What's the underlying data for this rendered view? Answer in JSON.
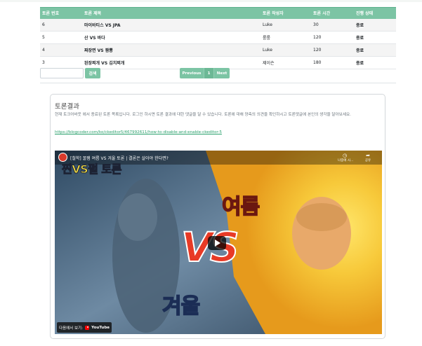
{
  "table": {
    "headers": [
      "토론 번호",
      "토론 제목",
      "토론 작성자",
      "토론 시간",
      "진행 상태"
    ],
    "rows": [
      {
        "no": "6",
        "title": "마이바티스 VS JPA",
        "author": "Luke",
        "time": "30",
        "status": "종료"
      },
      {
        "no": "5",
        "title": "산 VS 바다",
        "author": "룽룽",
        "time": "120",
        "status": "종료"
      },
      {
        "no": "4",
        "title": "짜장면 VS 짬뽕",
        "author": "Luke",
        "time": "120",
        "status": "종료"
      },
      {
        "no": "3",
        "title": "된장찌개 VS 김치찌개",
        "author": "제이슨",
        "time": "180",
        "status": "종료"
      }
    ]
  },
  "search": {
    "placeholder": "",
    "button_label": "검색"
  },
  "pagination": {
    "prev_label": "Previous",
    "current_page": "1",
    "next_label": "Next"
  },
  "result_card": {
    "title": "토론결과",
    "description": "현재 토크어바웃 에서 종료된 토론 목록입니다. 로그인 하시면 토론 결과에 대한 댓글을 달 수 있습니다. 토론에 대해 양측의 의견을 확인하시고 토론댓글에 본인의 생각을 달아보세요.",
    "link": "https://blogcoder.com/ko/ckeditor5/467992611/how-to-disable-and-enable-ckeditor-5"
  },
  "video": {
    "title": "[철학] 꿀잼 여름 VS 겨울 토론 | 결론은 살아야 한다면?",
    "badge_text": "찐VS펄 토론",
    "left_caption": "겨울",
    "right_caption": "여름",
    "center_text": "VS",
    "watch_later_label": "나중에 시...",
    "share_label": "공유",
    "watch_on_label": "다음에서 보기:",
    "youtube_label": "YouTube"
  },
  "colors": {
    "accent": "#7cc4a4",
    "link": "#28a06b"
  },
  "icons": [
    "clock-icon",
    "share-icon",
    "play-icon",
    "youtube-icon",
    "channel-avatar-icon"
  ]
}
